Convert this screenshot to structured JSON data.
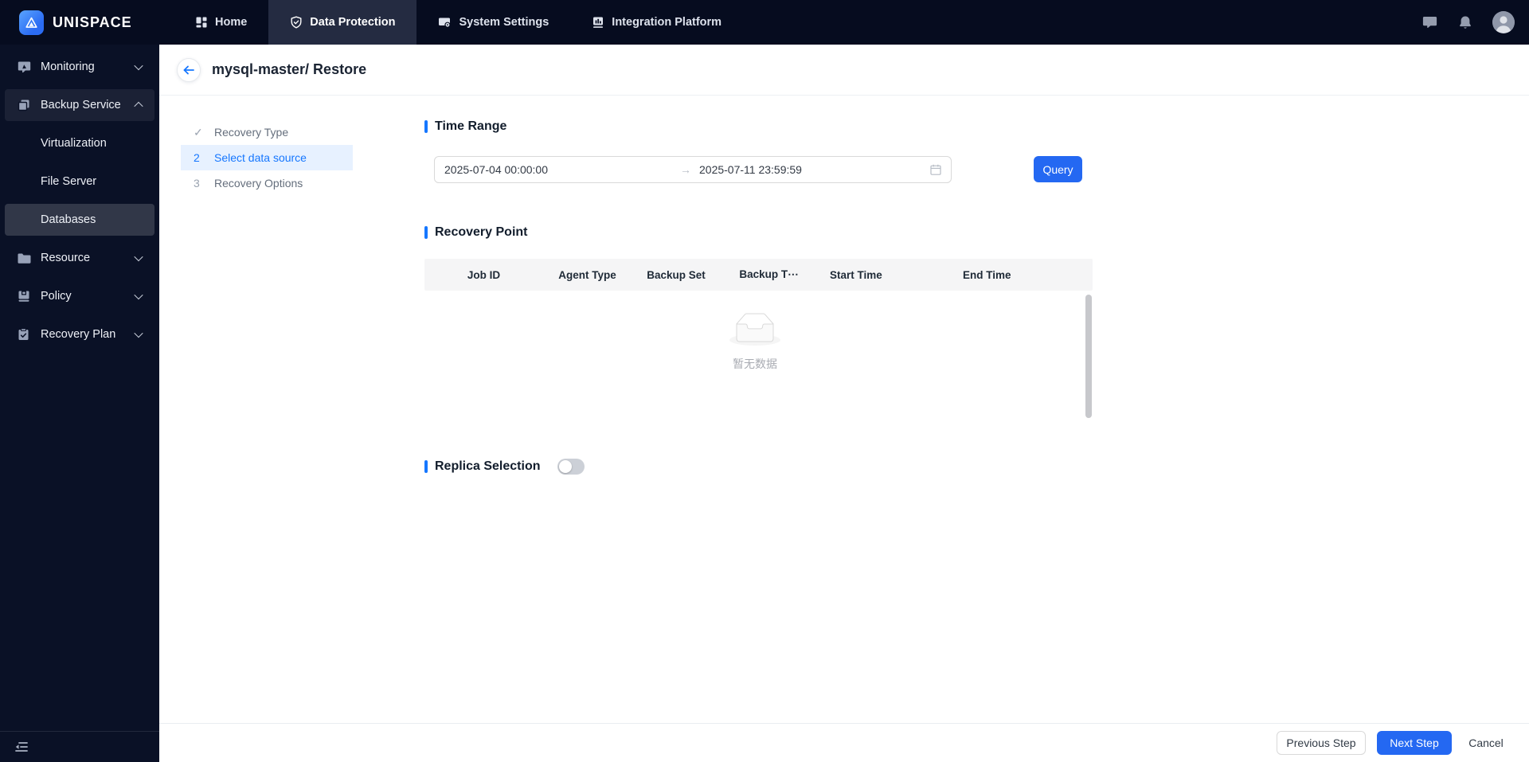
{
  "colors": {
    "accent_blue": "#2468f2",
    "link_blue": "#1677ff",
    "topbar_bg": "#060c1f",
    "sidebar_bg": "#0a1126",
    "step_active_bg": "#e7f1ff",
    "table_header_bg": "#f5f5f6"
  },
  "brand": {
    "name": "UNISPACE",
    "logo_icon": "mountain-logo-icon"
  },
  "topnav": {
    "tabs": [
      {
        "label": "Home",
        "icon": "grid-icon",
        "active": false
      },
      {
        "label": "Data Protection",
        "icon": "shield-check-icon",
        "active": true
      },
      {
        "label": "System Settings",
        "icon": "monitor-settings-icon",
        "active": false
      },
      {
        "label": "Integration Platform",
        "icon": "bar-chart-icon",
        "active": false
      }
    ],
    "right_icons": [
      "chat-icon",
      "bell-icon",
      "user-avatar"
    ]
  },
  "sidebar": {
    "items": [
      {
        "label": "Monitoring",
        "icon": "screen-cursor-icon",
        "chevron": "down"
      },
      {
        "label": "Backup Service",
        "icon": "copy-icon",
        "chevron": "up",
        "expanded": true
      },
      {
        "label": "Virtualization",
        "child_of": "Backup Service"
      },
      {
        "label": "File Server",
        "child_of": "Backup Service"
      },
      {
        "label": "Databases",
        "child_of": "Backup Service",
        "selected": true
      },
      {
        "label": "Resource",
        "icon": "folder-icon",
        "chevron": "down"
      },
      {
        "label": "Policy",
        "icon": "save-icon",
        "chevron": "down"
      },
      {
        "label": "Recovery Plan",
        "icon": "clipboard-check-icon",
        "chevron": "down"
      }
    ],
    "collapse_icon": "menu-fold-icon"
  },
  "page": {
    "title": "mysql-master/ Restore",
    "back_icon": "arrow-left-icon"
  },
  "steps": [
    {
      "marker": "✓",
      "label": "Recovery Type",
      "state": "done"
    },
    {
      "marker": "2",
      "label": "Select data source",
      "state": "active"
    },
    {
      "marker": "3",
      "label": "Recovery Options",
      "state": "pending"
    }
  ],
  "time_range": {
    "title": "Time Range",
    "start": "2025-07-04 00:00:00",
    "separator": "→",
    "end": "2025-07-11 23:59:59",
    "calendar_icon": "calendar-icon",
    "query_label": "Query"
  },
  "recovery_point": {
    "title": "Recovery Point",
    "columns": [
      "Job ID",
      "Agent Type",
      "Backup Set",
      "Backup T⋯",
      "Start Time",
      "End Time"
    ],
    "rows": [],
    "empty_text": "暂无数据",
    "empty_icon": "empty-inbox-icon"
  },
  "replica": {
    "title": "Replica Selection",
    "toggle_state": "off"
  },
  "footer": {
    "previous_label": "Previous Step",
    "next_label": "Next Step",
    "cancel_label": "Cancel"
  }
}
